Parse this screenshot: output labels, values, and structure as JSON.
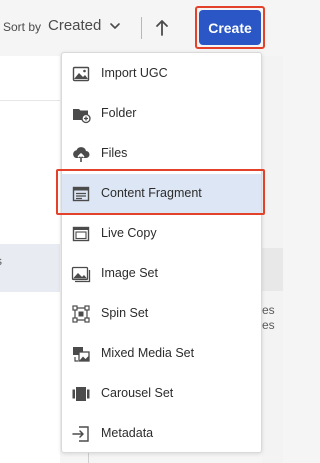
{
  "toolbar": {
    "sort_label": "Sort by",
    "sort_value": "Created",
    "create_label": "Create"
  },
  "background": {
    "fragment_left": "s",
    "fragment_right_1": "es",
    "fragment_right_2": "es"
  },
  "menu": {
    "items": [
      {
        "label": "Import UGC",
        "icon": "image-icon"
      },
      {
        "label": "Folder",
        "icon": "folder-add-icon"
      },
      {
        "label": "Files",
        "icon": "cloud-upload-icon"
      },
      {
        "label": "Content Fragment",
        "icon": "content-fragment-icon",
        "selected": true
      },
      {
        "label": "Live Copy",
        "icon": "live-copy-icon"
      },
      {
        "label": "Image Set",
        "icon": "image-set-icon"
      },
      {
        "label": "Spin Set",
        "icon": "spin-set-icon"
      },
      {
        "label": "Mixed Media Set",
        "icon": "mixed-media-set-icon"
      },
      {
        "label": "Carousel Set",
        "icon": "carousel-set-icon"
      },
      {
        "label": "Metadata",
        "icon": "metadata-import-icon"
      }
    ]
  },
  "colors": {
    "accent": "#2b56c6",
    "highlight_border": "#e3412a",
    "selected_row": "#dde6f5"
  }
}
